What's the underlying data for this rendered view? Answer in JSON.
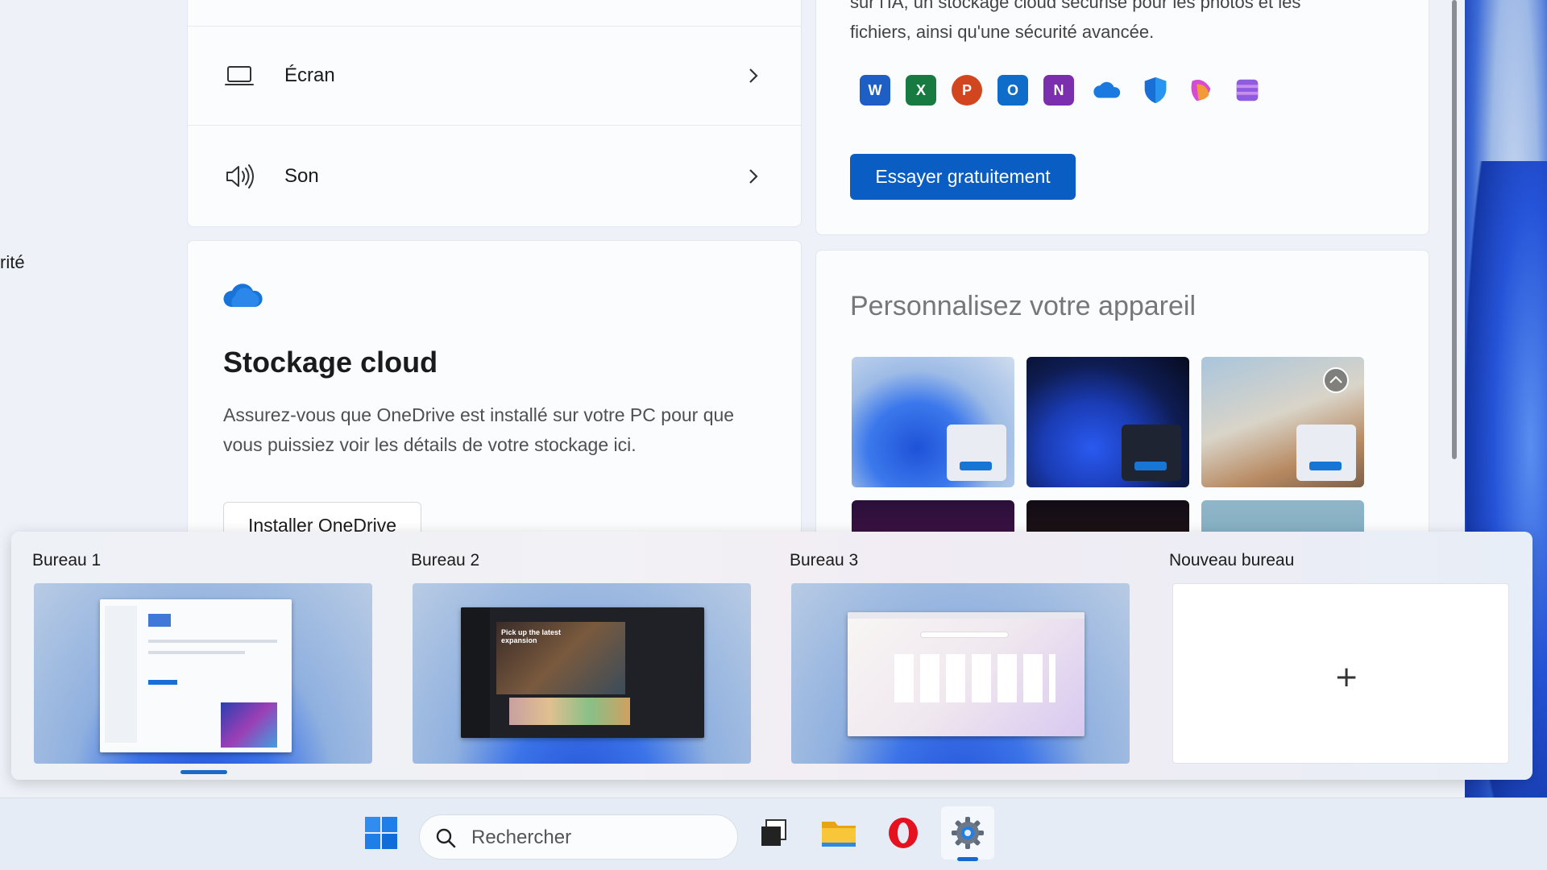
{
  "settings": {
    "sidebar_fragment": "rité",
    "list_items": [
      {
        "label": "Écran",
        "icon": "monitor-icon"
      },
      {
        "label": "Son",
        "icon": "speaker-icon"
      }
    ],
    "m365": {
      "text_line1": "sur l'IA, un stockage cloud sécurisé pour les photos et les",
      "text_line2": "fichiers, ainsi qu'une sécurité avancée.",
      "apps": [
        "W",
        "X",
        "P",
        "O",
        "N",
        "onedrive",
        "defender",
        "copilot",
        "clipchamp"
      ],
      "button_label": "Essayer gratuitement"
    },
    "cloud": {
      "title": "Stockage cloud",
      "description": "Assurez-vous que OneDrive est installé sur votre PC pour que vous puissiez voir les détails de votre stockage ici.",
      "button_label": "Installer OneDrive"
    },
    "personalize": {
      "title": "Personnalisez votre appareil"
    }
  },
  "taskview": {
    "desktops": [
      {
        "name": "Bureau 1",
        "selected": true
      },
      {
        "name": "Bureau 2",
        "selected": false
      },
      {
        "name": "Bureau 3",
        "selected": false
      }
    ],
    "new_desktop_label": "Nouveau bureau",
    "new_desktop_symbol": "+",
    "thumb_text_d2": "Pick up the latest expansion"
  },
  "taskbar": {
    "search_placeholder": "Rechercher",
    "items": [
      "start-icon",
      "search",
      "task-view-icon",
      "file-explorer-icon",
      "opera-icon",
      "settings-icon"
    ]
  },
  "colors": {
    "accent": "#0a5dc2",
    "taskbar_indicator": "#1669d1"
  }
}
